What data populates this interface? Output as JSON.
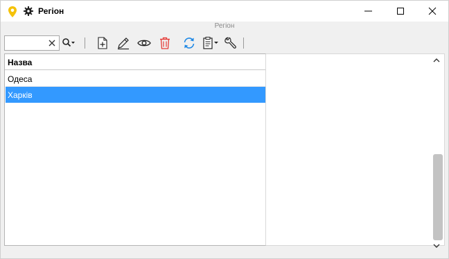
{
  "window": {
    "title": "Регіон",
    "app_icon": "map-pin-icon",
    "settings_icon": "gear-icon",
    "controls": [
      "minimize-icon",
      "maximize-icon",
      "close-icon"
    ]
  },
  "subtitle": "Регіон",
  "toolbar": {
    "search": {
      "value": "",
      "placeholder": ""
    },
    "buttons": [
      "search-dropdown-icon",
      "add-document-icon",
      "edit-pencil-icon",
      "view-eye-icon",
      "delete-trash-icon",
      "refresh-icon",
      "clipboard-dropdown-icon",
      "wrench-icon"
    ]
  },
  "grid": {
    "columns": [
      "Назва"
    ],
    "rows": [
      "Одеса",
      "Харків"
    ],
    "selected_row": 1
  },
  "colors": {
    "selection": "#3399ff",
    "pin": "#f5c20a",
    "delete": "#e53935",
    "refresh": "#1e88e5"
  }
}
